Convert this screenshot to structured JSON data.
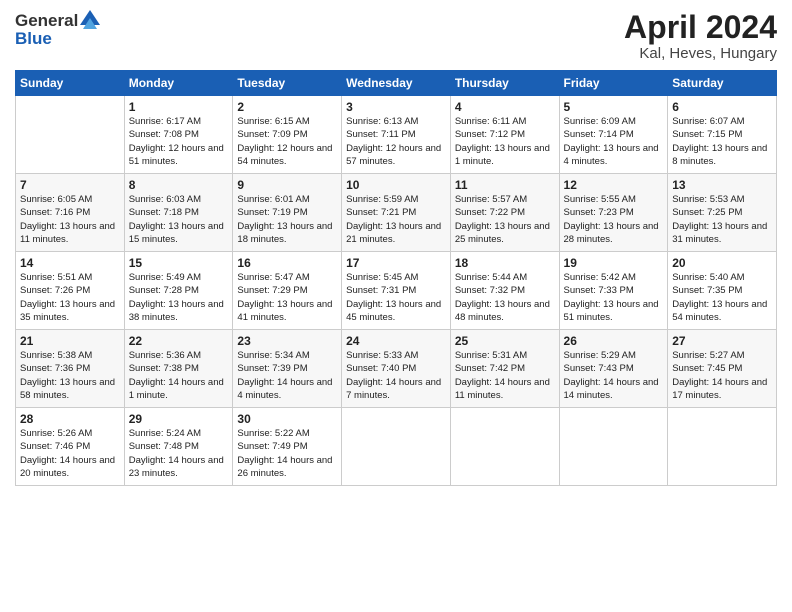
{
  "header": {
    "logo_line1": "General",
    "logo_line2": "Blue",
    "title": "April 2024",
    "subtitle": "Kal, Heves, Hungary"
  },
  "weekdays": [
    "Sunday",
    "Monday",
    "Tuesday",
    "Wednesday",
    "Thursday",
    "Friday",
    "Saturday"
  ],
  "weeks": [
    [
      {
        "date": "",
        "sunrise": "",
        "sunset": "",
        "daylight": ""
      },
      {
        "date": "1",
        "sunrise": "Sunrise: 6:17 AM",
        "sunset": "Sunset: 7:08 PM",
        "daylight": "Daylight: 12 hours and 51 minutes."
      },
      {
        "date": "2",
        "sunrise": "Sunrise: 6:15 AM",
        "sunset": "Sunset: 7:09 PM",
        "daylight": "Daylight: 12 hours and 54 minutes."
      },
      {
        "date": "3",
        "sunrise": "Sunrise: 6:13 AM",
        "sunset": "Sunset: 7:11 PM",
        "daylight": "Daylight: 12 hours and 57 minutes."
      },
      {
        "date": "4",
        "sunrise": "Sunrise: 6:11 AM",
        "sunset": "Sunset: 7:12 PM",
        "daylight": "Daylight: 13 hours and 1 minute."
      },
      {
        "date": "5",
        "sunrise": "Sunrise: 6:09 AM",
        "sunset": "Sunset: 7:14 PM",
        "daylight": "Daylight: 13 hours and 4 minutes."
      },
      {
        "date": "6",
        "sunrise": "Sunrise: 6:07 AM",
        "sunset": "Sunset: 7:15 PM",
        "daylight": "Daylight: 13 hours and 8 minutes."
      }
    ],
    [
      {
        "date": "7",
        "sunrise": "Sunrise: 6:05 AM",
        "sunset": "Sunset: 7:16 PM",
        "daylight": "Daylight: 13 hours and 11 minutes."
      },
      {
        "date": "8",
        "sunrise": "Sunrise: 6:03 AM",
        "sunset": "Sunset: 7:18 PM",
        "daylight": "Daylight: 13 hours and 15 minutes."
      },
      {
        "date": "9",
        "sunrise": "Sunrise: 6:01 AM",
        "sunset": "Sunset: 7:19 PM",
        "daylight": "Daylight: 13 hours and 18 minutes."
      },
      {
        "date": "10",
        "sunrise": "Sunrise: 5:59 AM",
        "sunset": "Sunset: 7:21 PM",
        "daylight": "Daylight: 13 hours and 21 minutes."
      },
      {
        "date": "11",
        "sunrise": "Sunrise: 5:57 AM",
        "sunset": "Sunset: 7:22 PM",
        "daylight": "Daylight: 13 hours and 25 minutes."
      },
      {
        "date": "12",
        "sunrise": "Sunrise: 5:55 AM",
        "sunset": "Sunset: 7:23 PM",
        "daylight": "Daylight: 13 hours and 28 minutes."
      },
      {
        "date": "13",
        "sunrise": "Sunrise: 5:53 AM",
        "sunset": "Sunset: 7:25 PM",
        "daylight": "Daylight: 13 hours and 31 minutes."
      }
    ],
    [
      {
        "date": "14",
        "sunrise": "Sunrise: 5:51 AM",
        "sunset": "Sunset: 7:26 PM",
        "daylight": "Daylight: 13 hours and 35 minutes."
      },
      {
        "date": "15",
        "sunrise": "Sunrise: 5:49 AM",
        "sunset": "Sunset: 7:28 PM",
        "daylight": "Daylight: 13 hours and 38 minutes."
      },
      {
        "date": "16",
        "sunrise": "Sunrise: 5:47 AM",
        "sunset": "Sunset: 7:29 PM",
        "daylight": "Daylight: 13 hours and 41 minutes."
      },
      {
        "date": "17",
        "sunrise": "Sunrise: 5:45 AM",
        "sunset": "Sunset: 7:31 PM",
        "daylight": "Daylight: 13 hours and 45 minutes."
      },
      {
        "date": "18",
        "sunrise": "Sunrise: 5:44 AM",
        "sunset": "Sunset: 7:32 PM",
        "daylight": "Daylight: 13 hours and 48 minutes."
      },
      {
        "date": "19",
        "sunrise": "Sunrise: 5:42 AM",
        "sunset": "Sunset: 7:33 PM",
        "daylight": "Daylight: 13 hours and 51 minutes."
      },
      {
        "date": "20",
        "sunrise": "Sunrise: 5:40 AM",
        "sunset": "Sunset: 7:35 PM",
        "daylight": "Daylight: 13 hours and 54 minutes."
      }
    ],
    [
      {
        "date": "21",
        "sunrise": "Sunrise: 5:38 AM",
        "sunset": "Sunset: 7:36 PM",
        "daylight": "Daylight: 13 hours and 58 minutes."
      },
      {
        "date": "22",
        "sunrise": "Sunrise: 5:36 AM",
        "sunset": "Sunset: 7:38 PM",
        "daylight": "Daylight: 14 hours and 1 minute."
      },
      {
        "date": "23",
        "sunrise": "Sunrise: 5:34 AM",
        "sunset": "Sunset: 7:39 PM",
        "daylight": "Daylight: 14 hours and 4 minutes."
      },
      {
        "date": "24",
        "sunrise": "Sunrise: 5:33 AM",
        "sunset": "Sunset: 7:40 PM",
        "daylight": "Daylight: 14 hours and 7 minutes."
      },
      {
        "date": "25",
        "sunrise": "Sunrise: 5:31 AM",
        "sunset": "Sunset: 7:42 PM",
        "daylight": "Daylight: 14 hours and 11 minutes."
      },
      {
        "date": "26",
        "sunrise": "Sunrise: 5:29 AM",
        "sunset": "Sunset: 7:43 PM",
        "daylight": "Daylight: 14 hours and 14 minutes."
      },
      {
        "date": "27",
        "sunrise": "Sunrise: 5:27 AM",
        "sunset": "Sunset: 7:45 PM",
        "daylight": "Daylight: 14 hours and 17 minutes."
      }
    ],
    [
      {
        "date": "28",
        "sunrise": "Sunrise: 5:26 AM",
        "sunset": "Sunset: 7:46 PM",
        "daylight": "Daylight: 14 hours and 20 minutes."
      },
      {
        "date": "29",
        "sunrise": "Sunrise: 5:24 AM",
        "sunset": "Sunset: 7:48 PM",
        "daylight": "Daylight: 14 hours and 23 minutes."
      },
      {
        "date": "30",
        "sunrise": "Sunrise: 5:22 AM",
        "sunset": "Sunset: 7:49 PM",
        "daylight": "Daylight: 14 hours and 26 minutes."
      },
      {
        "date": "",
        "sunrise": "",
        "sunset": "",
        "daylight": ""
      },
      {
        "date": "",
        "sunrise": "",
        "sunset": "",
        "daylight": ""
      },
      {
        "date": "",
        "sunrise": "",
        "sunset": "",
        "daylight": ""
      },
      {
        "date": "",
        "sunrise": "",
        "sunset": "",
        "daylight": ""
      }
    ]
  ]
}
